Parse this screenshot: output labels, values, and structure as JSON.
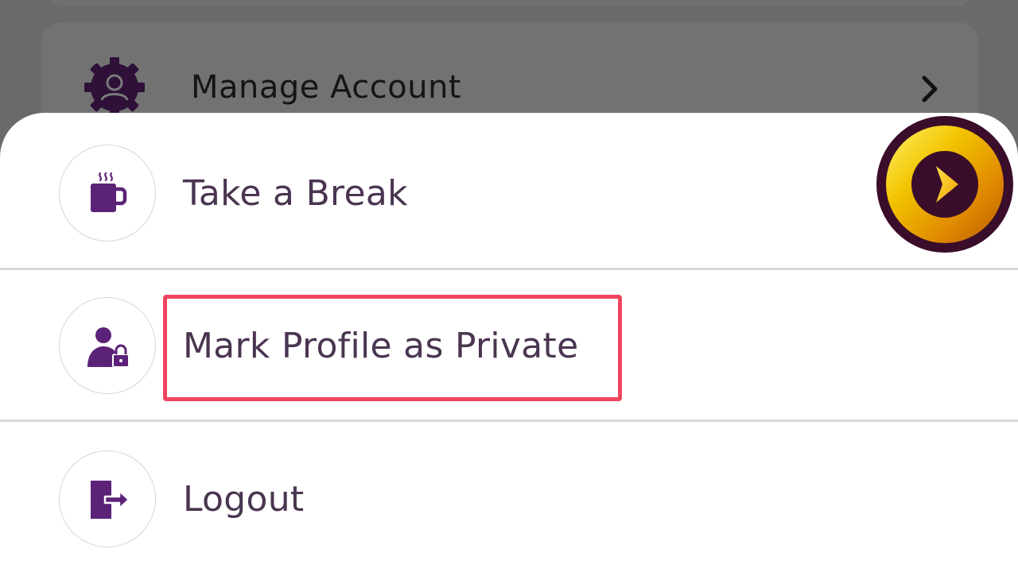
{
  "background": {
    "manage_account": {
      "label": "Manage Account",
      "icon": "gear-user-icon",
      "chevron_icon": "chevron-right-icon"
    }
  },
  "sheet": {
    "items": [
      {
        "label": "Take a Break",
        "icon": "coffee-cup-icon"
      },
      {
        "label": "Mark Profile as Private",
        "icon": "user-lock-icon",
        "highlighted": true
      },
      {
        "label": "Logout",
        "icon": "logout-icon"
      }
    ]
  },
  "overlay": {
    "logo_icon": "play-logo-icon",
    "highlight_color": "#f0445f"
  },
  "colors": {
    "icon_purple": "#5c2278",
    "text": "#4a3550",
    "dim_background": "#6a6a6a",
    "sheet_background": "#ffffff"
  }
}
